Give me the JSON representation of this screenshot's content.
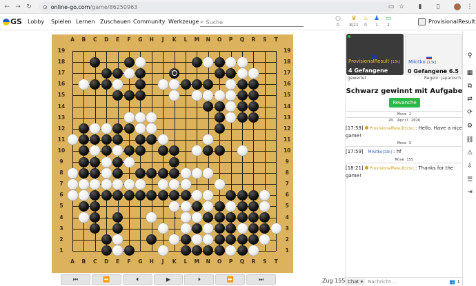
{
  "browser": {
    "back_icon": "arrow-left-icon",
    "forward_icon": "arrow-right-icon",
    "reload_icon": "reload-icon",
    "url_domain": "online-go.com",
    "url_path": "/game/86250963"
  },
  "header": {
    "logo_text": "GS",
    "nav": [
      "Lobby",
      "Spielen",
      "Lernen",
      "Zuschauen",
      "Community",
      "Werkzeuge"
    ],
    "search_placeholder": "Suche",
    "stats": [
      {
        "icon": "circle-icon",
        "value": "0"
      },
      {
        "icon": "trophy-icon",
        "value": "8/21"
      },
      {
        "icon": "lightbulb-icon",
        "value": "0"
      },
      {
        "icon": "person-icon",
        "value": "1"
      },
      {
        "icon": "monitor-icon",
        "value": "2"
      }
    ],
    "username": "ProvisionalResult"
  },
  "board": {
    "size": 19,
    "columns": [
      "A",
      "B",
      "C",
      "D",
      "E",
      "F",
      "G",
      "H",
      "J",
      "K",
      "L",
      "M",
      "N",
      "O",
      "P",
      "Q",
      "R",
      "S",
      "T"
    ],
    "rows": [
      "19",
      "18",
      "17",
      "16",
      "15",
      "14",
      "13",
      "12",
      "11",
      "10",
      "9",
      "8",
      "7",
      "6",
      "5",
      "4",
      "3",
      "2",
      "1"
    ],
    "black": [
      "C18",
      "F18",
      "M18",
      "O18",
      "D17",
      "E17",
      "G17",
      "O17",
      "P17",
      "C16",
      "D16",
      "G16",
      "L16",
      "M16",
      "N16",
      "Q16",
      "R16",
      "E15",
      "F15",
      "G15",
      "Q15",
      "R15",
      "N14",
      "O14",
      "Q14",
      "R14",
      "O13",
      "Q13",
      "R13",
      "D11",
      "B12",
      "E12",
      "F12",
      "O12",
      "B11",
      "C11",
      "E11",
      "G11",
      "H11",
      "B10",
      "D10",
      "F10",
      "G10",
      "J10",
      "K10",
      "N10",
      "O10",
      "B9",
      "C9",
      "E9",
      "K9",
      "B8",
      "C8",
      "E8",
      "G8",
      "H8",
      "J8",
      "K8",
      "C6",
      "D6",
      "E6",
      "F6",
      "G6",
      "H6",
      "J6",
      "K6",
      "L6",
      "P6",
      "Q6",
      "R6",
      "B5",
      "C5",
      "M5",
      "O5",
      "Q5",
      "R5",
      "C4",
      "E4",
      "N4",
      "O4",
      "P4",
      "Q4",
      "R4",
      "S4",
      "C3",
      "E3",
      "M3",
      "O3",
      "P3",
      "R3",
      "S3",
      "D2",
      "H2",
      "L2",
      "O2",
      "P2",
      "Q2",
      "R2",
      "D1",
      "F1",
      "L1",
      "M1",
      "N1",
      "O1",
      "Q1"
    ],
    "white": [
      "F17",
      "G18",
      "N18",
      "P18",
      "Q18",
      "Q17",
      "R17",
      "B16",
      "E16",
      "J16",
      "K16",
      "P16",
      "O15",
      "P15",
      "Q15b",
      "K15",
      "M15",
      "N15",
      "P14",
      "P13",
      "F13",
      "G13",
      "H13",
      "C12",
      "D12",
      "G12",
      "H12",
      "N11",
      "A11",
      "J11",
      "Q10",
      "C10",
      "E10",
      "M10",
      "D9",
      "F9",
      "A8",
      "D8",
      "L8",
      "M8",
      "N8",
      "A7",
      "B7",
      "D7",
      "E7",
      "F7",
      "J7",
      "K7",
      "L7",
      "O7",
      "C7",
      "G7",
      "A6",
      "B6",
      "M6",
      "N6",
      "S6",
      "K5",
      "L5",
      "N5",
      "P5",
      "S5",
      "B4",
      "H4",
      "L4",
      "M4",
      "J3",
      "L3",
      "N3",
      "Q3",
      "T3",
      "E2",
      "K2",
      "M2",
      "N2",
      "S2",
      "E1",
      "J1",
      "P1",
      "R1"
    ],
    "last_move": "K17",
    "last_move_color": "b"
  },
  "controls": {
    "buttons": [
      {
        "name": "first-move-button",
        "label": "⏮"
      },
      {
        "name": "back-10-button",
        "label": "⏪"
      },
      {
        "name": "back-1-button",
        "label": "⏴"
      },
      {
        "name": "play-button",
        "label": "▶"
      },
      {
        "name": "forward-1-button",
        "label": "⏵"
      },
      {
        "name": "forward-10-button",
        "label": "⏩"
      },
      {
        "name": "last-move-button",
        "label": "⏭"
      }
    ],
    "move_label": "Zug 155"
  },
  "players": {
    "black": {
      "name": "ProvisionalResult",
      "rank": "[13k]",
      "captures": "4 Gefangene"
    },
    "white": {
      "name": "Mikitko",
      "rank": "[13k]",
      "captures": "0 Gefangene",
      "komi": "+ 6.5"
    }
  },
  "game": {
    "rated": "gewertet",
    "rules": "Regeln: Japanisch",
    "result": "Schwarz gewinnt mit Aufgabe",
    "rematch": "Revanche"
  },
  "chat": {
    "sep1": "Move 1",
    "date": "20. April 2026",
    "m1_time": "[17:59]",
    "m1_who": "ProvisionalResult",
    "m1_rank": "[13k]",
    "m1_text": ": Hello. Have a nice game!",
    "sep2": "Move 3",
    "m2_time": "[17:59]",
    "m2_who": "Mikitko",
    "m2_rank": "[13k]",
    "m2_text": ": hf",
    "sep3": "Move 155",
    "m3_time": "[18:21]",
    "m3_who": "ProvisionalResult",
    "m3_rank": "[13k]",
    "m3_text": ": Thanks for the game!",
    "channel": "Chat",
    "placeholder": "Nachricht ...",
    "users": "1"
  },
  "colors": {
    "board": "#dcb35c",
    "rematch": "#2db84a",
    "black_name": "#f0c03a",
    "white_name": "#2d5fb8"
  }
}
